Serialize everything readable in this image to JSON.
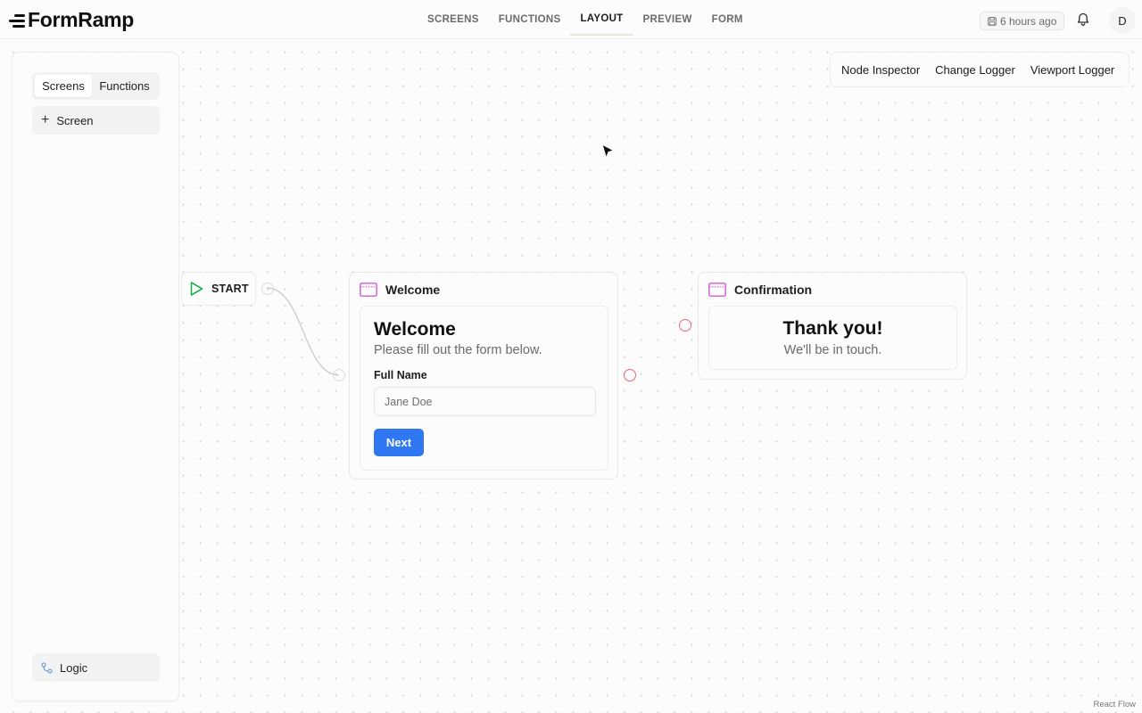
{
  "app": {
    "brand": "FormRamp"
  },
  "nav": {
    "tabs": [
      {
        "label": "SCREENS"
      },
      {
        "label": "FUNCTIONS"
      },
      {
        "label": "LAYOUT",
        "active": true
      },
      {
        "label": "PREVIEW"
      },
      {
        "label": "FORM"
      }
    ]
  },
  "header": {
    "saved_status": "6 hours ago",
    "avatar_initial": "D"
  },
  "sidebar": {
    "segments": [
      {
        "label": "Screens",
        "active": true
      },
      {
        "label": "Functions",
        "active": false
      }
    ],
    "add_screen_label": "Screen",
    "logic_label": "Logic"
  },
  "logger": {
    "buttons": [
      {
        "label": "Node Inspector"
      },
      {
        "label": "Change Logger"
      },
      {
        "label": "Viewport Logger"
      }
    ]
  },
  "flow": {
    "start_node": {
      "label": "START"
    },
    "welcome_node": {
      "title": "Welcome",
      "heading": "Welcome",
      "subtitle": "Please fill out the form below.",
      "field_label": "Full Name",
      "field_placeholder": "Jane Doe",
      "button_label": "Next"
    },
    "confirmation_node": {
      "title": "Confirmation",
      "heading": "Thank you!",
      "subtitle": "We'll be in touch."
    }
  },
  "icons": {
    "start": "play-icon",
    "screen": "screen-window-icon",
    "saved": "floppy-disk-icon",
    "notifications": "bell-icon",
    "logic": "logic-icon"
  },
  "colors": {
    "accent": "#2f78f2",
    "start_icon": "#22b14c",
    "screen_icon": "#d35ad3",
    "handle_unconnected": "#e26b78"
  },
  "attribution": "React Flow"
}
